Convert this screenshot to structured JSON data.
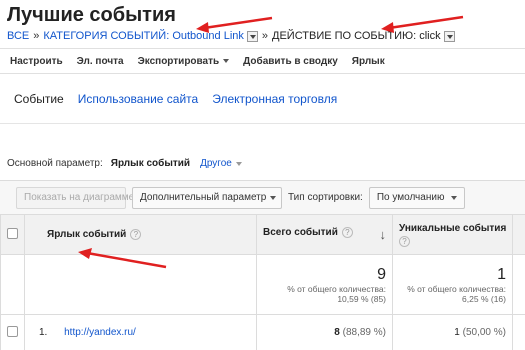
{
  "page": {
    "title": "Лучшие события"
  },
  "breadcrumb": {
    "all": "ВСЕ",
    "sep1": "»",
    "category": "КАТЕГОРИЯ СОБЫТИЙ: Outbound Link",
    "sep2": "»",
    "action": "ДЕЙСТВИЕ ПО СОБЫТИЮ: click"
  },
  "toolbar": {
    "customize": "Настроить",
    "email": "Эл. почта",
    "export": "Экспортировать",
    "add_to_dashboard": "Добавить в сводку",
    "shortcut": "Ярлык"
  },
  "tabs": [
    {
      "label": "Событие"
    },
    {
      "label": "Использование сайта"
    },
    {
      "label": "Электронная торговля"
    }
  ],
  "dimension": {
    "label": "Основной параметр:",
    "current": "Ярлык событий",
    "other": "Другое"
  },
  "controls": {
    "plot_rows": "Показать на диаграмме",
    "secondary_dimension": "Дополнительный параметр",
    "sort_type_label": "Тип сортировки:",
    "sort_type_value": "По умолчанию"
  },
  "table": {
    "columns": {
      "label": "Ярлык событий",
      "total_events": "Всего событий",
      "unique_events": "Уникальные события"
    },
    "totals": {
      "total_events": "9",
      "total_events_sub1": "% от общего количества:",
      "total_events_sub2": "10,59 % (85)",
      "unique_events": "1",
      "unique_events_sub1": "% от общего количества:",
      "unique_events_sub2": "6,25 % (16)"
    },
    "rows": [
      {
        "index": "1.",
        "label": "http://yandex.ru/",
        "total_events": "8",
        "total_events_pct": "(88,89 %)",
        "unique_events": "1",
        "unique_events_pct": "(50,00 %)"
      }
    ]
  },
  "colors": {
    "accent": "#1155cc",
    "annotation_arrow": "#e02020"
  }
}
